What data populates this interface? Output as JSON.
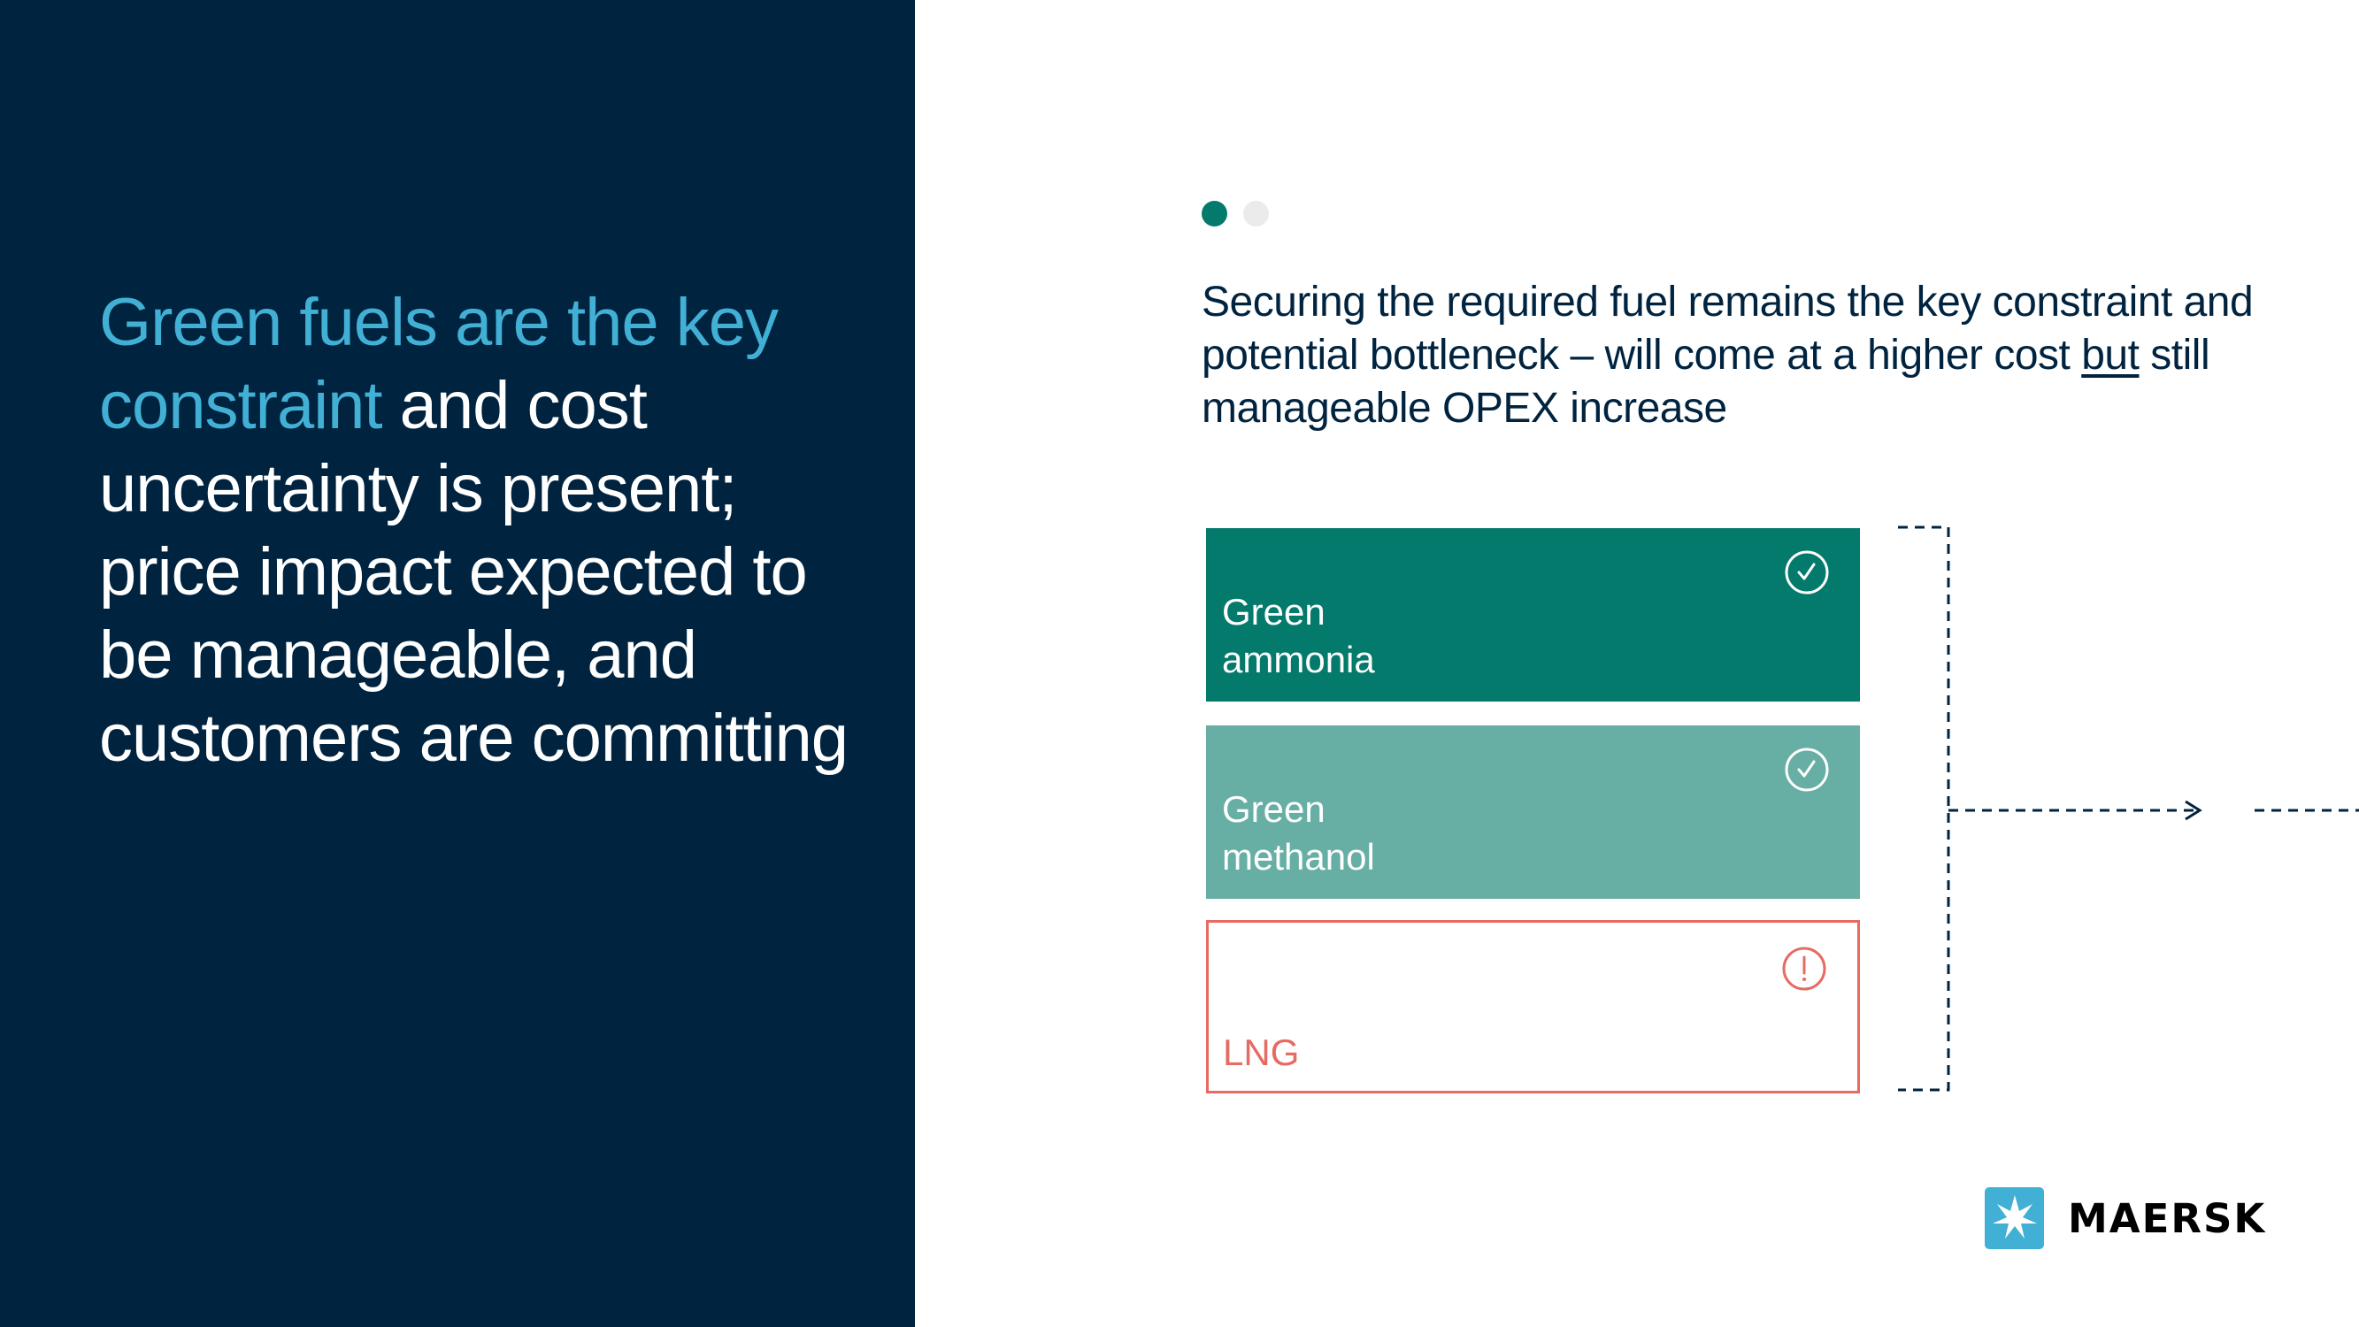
{
  "headline": {
    "highlight": "Green fuels are the key constraint",
    "rest": " and cost uncertainty is present; price impact expected to be manageable, and customers are committing"
  },
  "pager": {
    "total": 2,
    "active_index": 0
  },
  "subheading": {
    "before": "Securing the required fuel remains the key constraint and potential bottleneck – will come at a higher cost ",
    "underlined": "but",
    "after": " still manageable OPEX increase"
  },
  "fuels": [
    {
      "label": "Green\nammonia",
      "status": "check",
      "color": "#037a6b"
    },
    {
      "label": "Green\nmethanol",
      "status": "check",
      "color": "#67aea5"
    },
    {
      "label": "LNG",
      "status": "warning",
      "color": "#e56b63"
    }
  ],
  "colors": {
    "navy": "#00233f",
    "accent_blue": "#42b0d5",
    "teal_dark": "#037a6b",
    "teal_light": "#67aea5",
    "alert_red": "#e56b63"
  },
  "brand": {
    "name": "MAERSK",
    "icon": "seven-point-star-icon"
  }
}
